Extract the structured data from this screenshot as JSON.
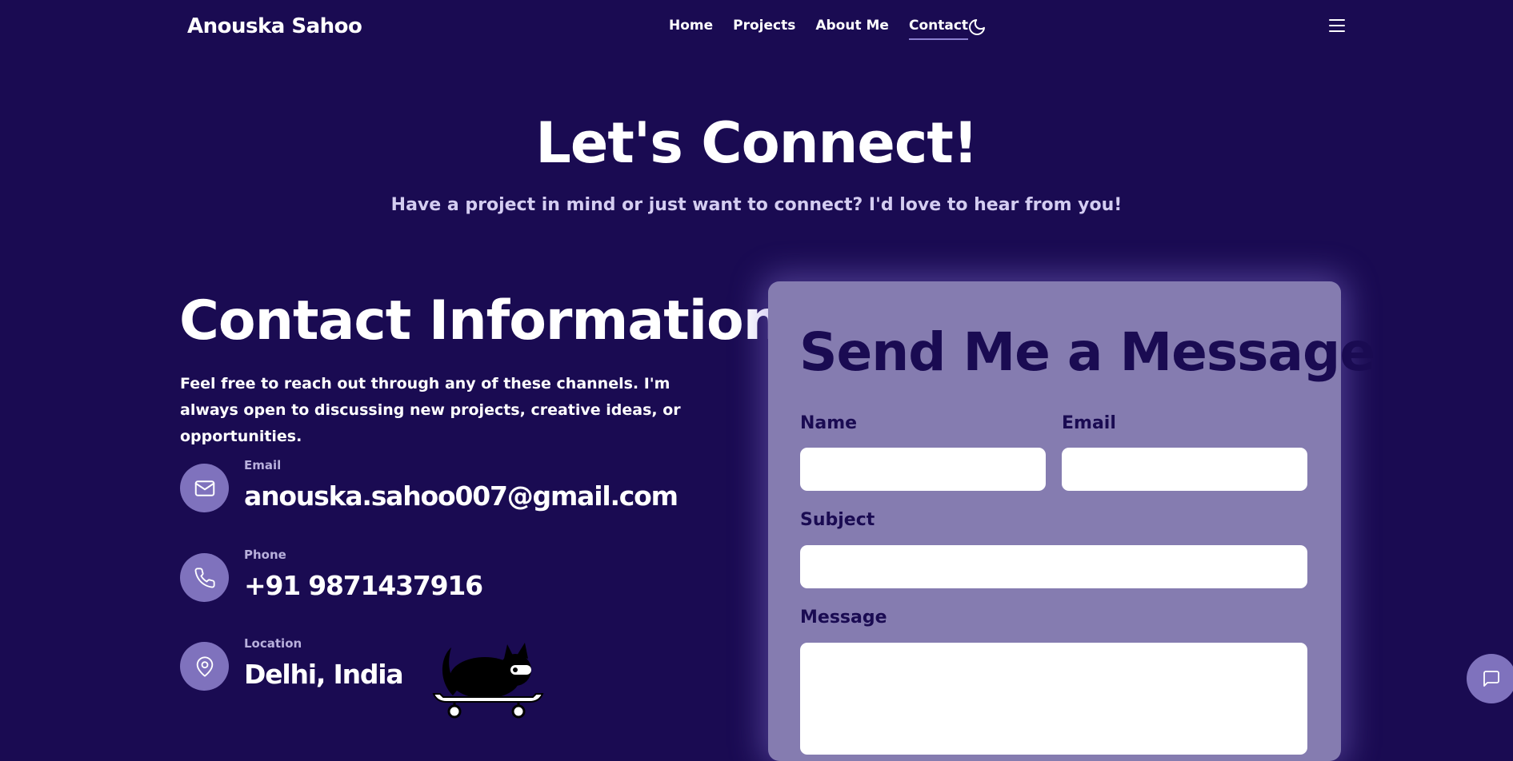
{
  "nav": {
    "brand": "Anouska Sahoo",
    "links": [
      {
        "label": "Home"
      },
      {
        "label": "Projects"
      },
      {
        "label": "About Me"
      },
      {
        "label": "Contact"
      }
    ],
    "active_link": "Contact",
    "theme_icon": "moon-icon",
    "menu_icon": "hamburger-menu-icon"
  },
  "hero": {
    "title": "Let's Connect!",
    "subtitle": "Have a project in mind or just want to connect? I'd love to hear from you!"
  },
  "contact_info": {
    "title": "Contact Information",
    "description": "Feel free to reach out through any of these channels. I'm always open to discussing new projects, creative ideas, or opportunities.",
    "items": [
      {
        "label": "Email",
        "value": "anouska.sahoo007@gmail.com",
        "icon": "mail-icon"
      },
      {
        "label": "Phone",
        "value": "+91 9871437916",
        "icon": "phone-icon"
      },
      {
        "label": "Location",
        "value": "Delhi, India",
        "icon": "map-pin-icon"
      }
    ]
  },
  "form": {
    "title": "Send Me a Message",
    "name_label": "Name",
    "email_label": "Email",
    "subject_label": "Subject",
    "message_label": "Message",
    "name_value": "",
    "email_value": "",
    "subject_value": "",
    "message_value": ""
  },
  "chat_icon": "chat-bubble-icon",
  "colors": {
    "background": "#1a0b52",
    "card": "#857cb0",
    "accent": "#7f72bd",
    "text_dark": "#1a0b52"
  }
}
